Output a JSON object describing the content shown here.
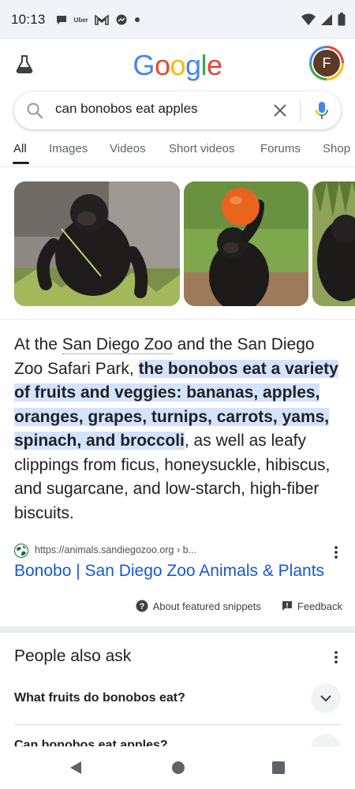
{
  "status_bar": {
    "time": "10:13",
    "uber_label": "Uber",
    "icons": [
      "chat-icon",
      "uber-icon",
      "gmail-icon",
      "messenger-icon",
      "dot-icon",
      "wifi-icon",
      "signal-icon",
      "battery-icon"
    ]
  },
  "header": {
    "logo_letters": [
      {
        "ch": "G",
        "color": "#4285f4"
      },
      {
        "ch": "o",
        "color": "#ea4335"
      },
      {
        "ch": "o",
        "color": "#fbbc05"
      },
      {
        "ch": "g",
        "color": "#4285f4"
      },
      {
        "ch": "l",
        "color": "#34a853"
      },
      {
        "ch": "e",
        "color": "#ea4335"
      }
    ],
    "avatar_letter": "F"
  },
  "search": {
    "query": "can bonobos eat apples"
  },
  "tabs": [
    {
      "label": "All",
      "active": true
    },
    {
      "label": "Images"
    },
    {
      "label": "Videos"
    },
    {
      "label": "Short videos"
    },
    {
      "label": "Forums"
    },
    {
      "label": "Shop"
    }
  ],
  "snippet": {
    "prefix": "At the ",
    "link1": "San Diego Zoo",
    "middle": " and the San Diego Zoo Safari Park, ",
    "highlight": "the bonobos eat a variety of fruits and veggies: bananas, apples, oranges, grapes, turnips, carrots, yams, spinach, and broccoli",
    "suffix": ", as well as leafy clippings from ficus, honeysuckle, hibiscus, and sugarcane, and low-starch, high-fiber biscuits.",
    "source_url": "https://animals.sandiegozoo.org › b...",
    "result_title": "Bonobo | San Diego Zoo Animals & Plants",
    "about_label": "About featured snippets",
    "feedback_label": "Feedback"
  },
  "people_also_ask": {
    "title": "People also ask",
    "questions": [
      "What fruits do bonobos eat?",
      "Can bonobos eat apples?"
    ]
  },
  "colors": {
    "link_blue": "#1558d6",
    "highlight": "#d3e3fd",
    "status_bar_bg": "#f1f3f9"
  }
}
